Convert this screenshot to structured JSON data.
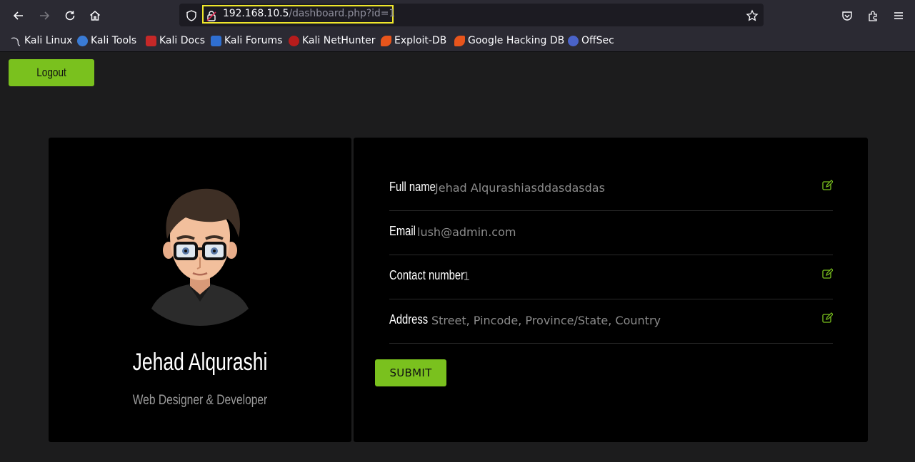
{
  "browser": {
    "url_host": "192.168.10.5",
    "url_path": "/dashboard.php?id=1"
  },
  "bookmarks": [
    {
      "label": "Kali Linux",
      "icon": "kali-dragon-icon"
    },
    {
      "label": "Kali Tools",
      "icon": "kali-tools-icon"
    },
    {
      "label": "Kali Docs",
      "icon": "kali-docs-icon"
    },
    {
      "label": "Kali Forums",
      "icon": "kali-forums-icon"
    },
    {
      "label": "Kali NetHunter",
      "icon": "nethunter-icon"
    },
    {
      "label": "Exploit-DB",
      "icon": "exploit-db-icon"
    },
    {
      "label": "Google Hacking DB",
      "icon": "ghdb-icon"
    },
    {
      "label": "OffSec",
      "icon": "offsec-icon"
    }
  ],
  "page": {
    "logout_label": "Logout",
    "profile": {
      "name": "Jehad Alqurashi",
      "role": "Web Designer & Developer"
    },
    "fields": [
      {
        "label": "Full name",
        "value": "Jehad Alqurashiasddasdasdas",
        "editable": true
      },
      {
        "label": "Email",
        "value": "lush@admin.com",
        "editable": false
      },
      {
        "label": "Contact number",
        "value": "1",
        "editable": true
      },
      {
        "label": "Address",
        "placeholder": "Street, Pincode, Province/State, Country",
        "editable": true
      }
    ],
    "submit_label": "SUBMIT"
  },
  "colors": {
    "accent": "#7ac11e",
    "url_highlight": "#f0e72b",
    "card_bg": "#000000",
    "page_bg": "#1c1c1d"
  }
}
